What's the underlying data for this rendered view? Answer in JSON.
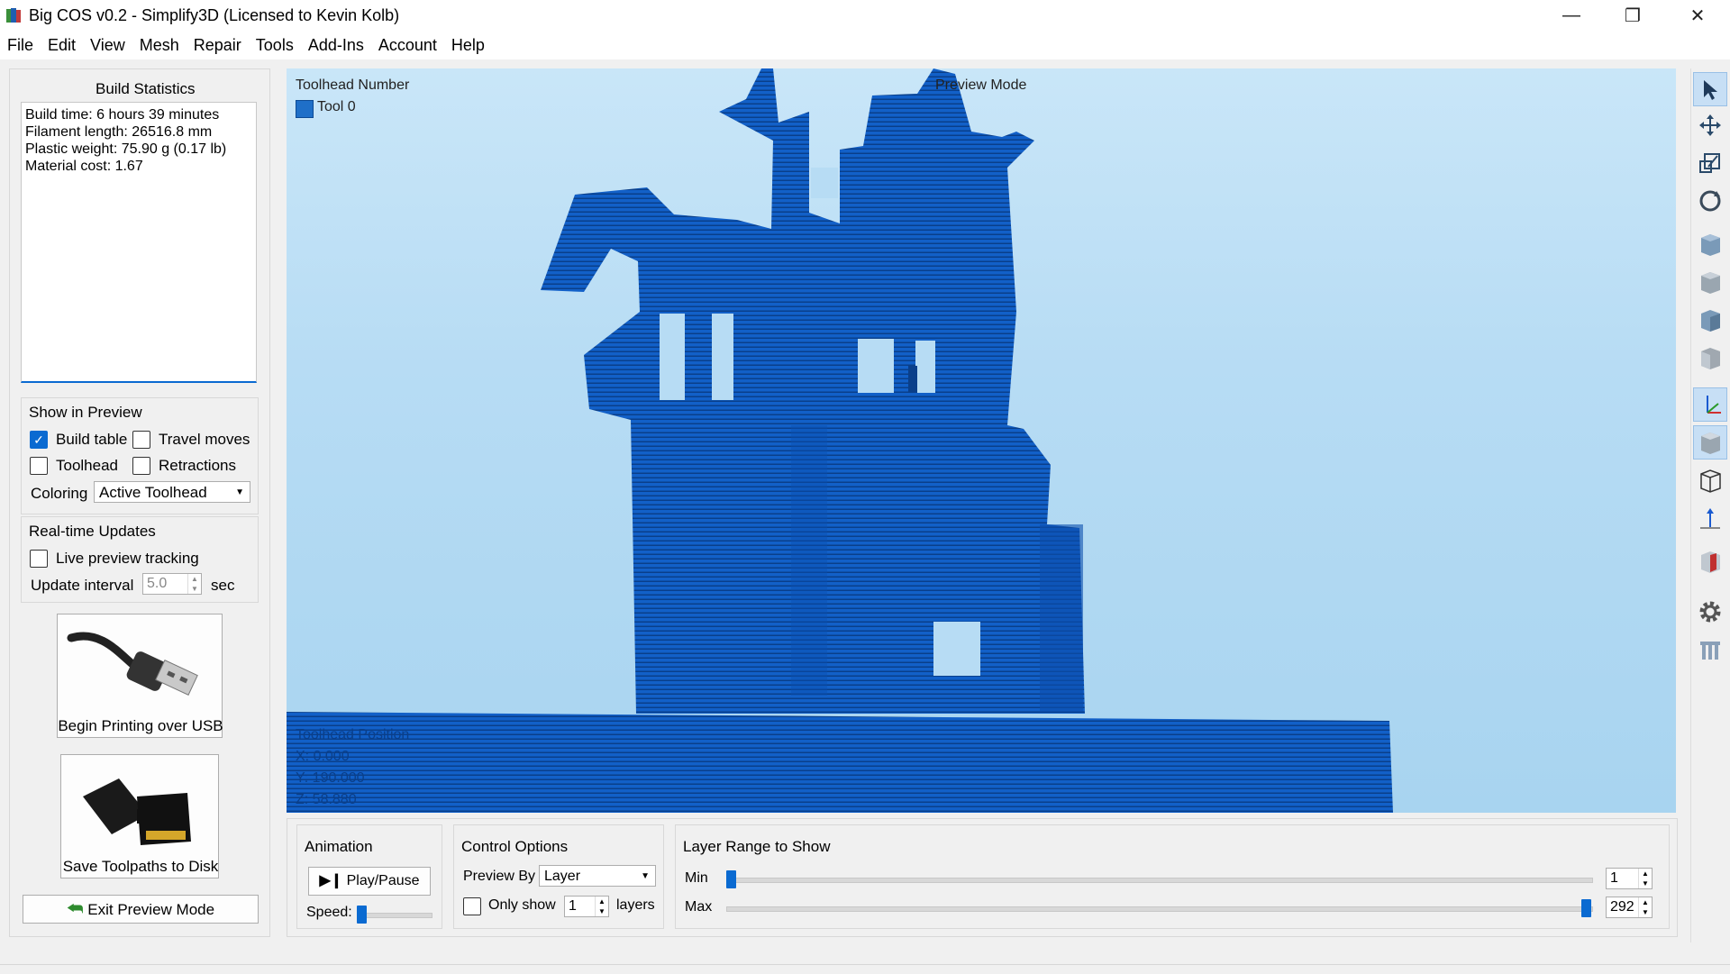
{
  "window": {
    "title": "Big COS v0.2 - Simplify3D (Licensed to Kevin Kolb)",
    "minimize": "—",
    "restore": "❐",
    "close": "✕"
  },
  "menu": [
    "File",
    "Edit",
    "View",
    "Mesh",
    "Repair",
    "Tools",
    "Add-Ins",
    "Account",
    "Help"
  ],
  "build_statistics": {
    "title": "Build Statistics",
    "lines": [
      "Build time: 6 hours 39 minutes",
      "Filament length: 26516.8 mm",
      "Plastic weight: 75.90 g (0.17 lb)",
      "Material cost: 1.67"
    ]
  },
  "show_in_preview": {
    "title": "Show in Preview",
    "build_table": {
      "label": "Build table",
      "checked": true
    },
    "travel_moves": {
      "label": "Travel moves",
      "checked": false
    },
    "toolhead": {
      "label": "Toolhead",
      "checked": false
    },
    "retractions": {
      "label": "Retractions",
      "checked": false
    },
    "coloring_label": "Coloring",
    "coloring_value": "Active Toolhead"
  },
  "realtime": {
    "title": "Real-time Updates",
    "live_tracking": {
      "label": "Live preview tracking",
      "checked": false
    },
    "interval_label": "Update interval",
    "interval_value": "5.0",
    "interval_unit": "sec"
  },
  "actions": {
    "usb_label": "Begin Printing over USB",
    "disk_label": "Save Toolpaths to Disk",
    "exit_label": "Exit Preview Mode"
  },
  "viewport": {
    "toolhead_number": "Toolhead Number",
    "tool0": "Tool 0",
    "tool_color": "#1f6fc8",
    "preview_mode": "Preview Mode",
    "toolhead_position": "Toolhead Position",
    "x": "X: 0.000",
    "y": "Y: 190.000",
    "z": "Z: 58.880",
    "model_color": "#1260c8"
  },
  "animation": {
    "title": "Animation",
    "play_label": "Play/Pause",
    "speed_label": "Speed:",
    "speed": 0.0
  },
  "control_options": {
    "title": "Control Options",
    "preview_by_label": "Preview By",
    "preview_by_value": "Layer",
    "only_show_label": "Only show",
    "only_show_checked": false,
    "only_show_value": "1",
    "layers_label": "layers"
  },
  "layer_range": {
    "title": "Layer Range to Show",
    "min_label": "Min",
    "max_label": "Max",
    "min_value": "1",
    "max_value": "292",
    "total_layers": 292
  },
  "toolbar_icons": [
    "select-icon",
    "move-icon",
    "scale-icon",
    "rotate-icon",
    "view-cube-1-icon",
    "view-cube-2-icon",
    "view-cube-3-icon",
    "view-cube-4-icon",
    "axes-icon",
    "solid-view-icon",
    "wireframe-view-icon",
    "normal-icon",
    "section-icon",
    "settings-gear-icon",
    "layers-icon"
  ]
}
